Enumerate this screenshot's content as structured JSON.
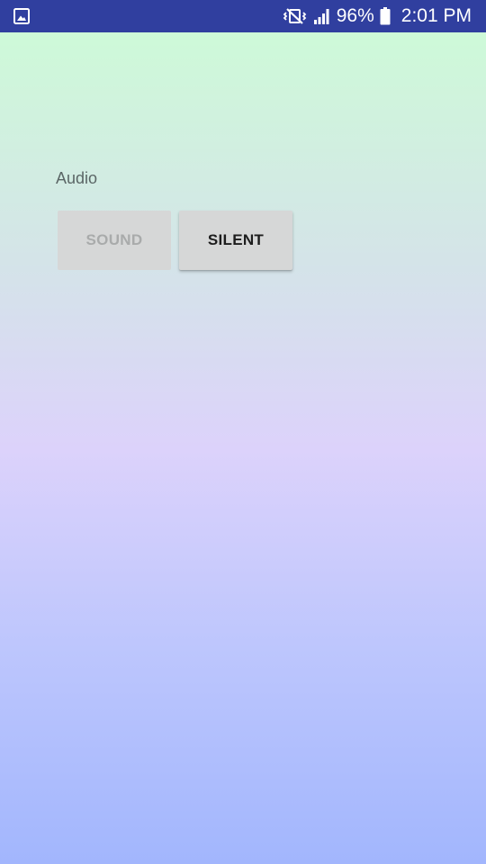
{
  "status_bar": {
    "left_icon": "image-notification-icon",
    "mute_icon": "vibrate-off-icon",
    "signal_icon": "signal-icon",
    "battery_percent": "96%",
    "battery_icon": "battery-icon",
    "time": "2:01 PM"
  },
  "main": {
    "section_label": "Audio",
    "buttons": [
      {
        "label": "SOUND",
        "state": "disabled"
      },
      {
        "label": "SILENT",
        "state": "enabled"
      }
    ]
  },
  "colors": {
    "status_bar_bg": "#303f9f",
    "gradient_top": "#cdfdd6",
    "gradient_mid": "#dcd2fb",
    "gradient_bottom": "#a2b6fd",
    "button_bg": "#d6d7d7"
  }
}
